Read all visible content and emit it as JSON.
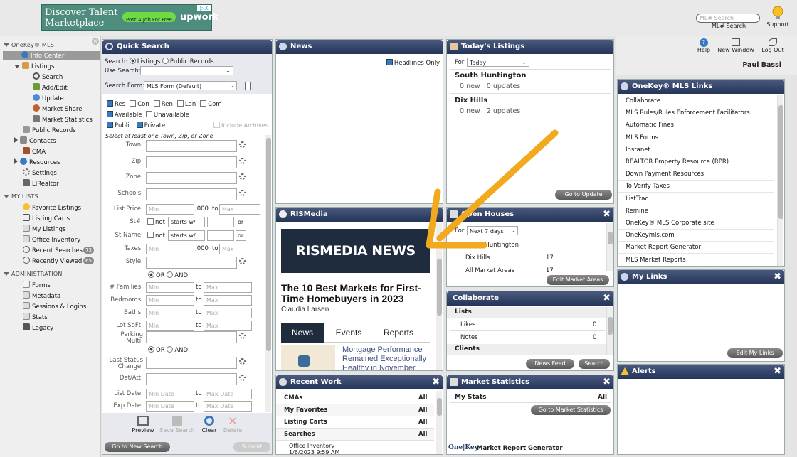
{
  "ad": {
    "line1": "Discover Talent",
    "line2": "Marketplace",
    "cta": "Post A Job For Free",
    "brand": "upwork",
    "badge": "▷X"
  },
  "header": {
    "search_placeholder": "ML# Search",
    "search_label": "ML# Search",
    "support": "Support",
    "help": "Help",
    "new_window": "New Window",
    "logout": "Log Out",
    "user": "Paul Bassi"
  },
  "sidebar": {
    "section_mls": "OneKey® MLS",
    "info_center": "Info Center",
    "listings": "Listings",
    "search": "Search",
    "add_edit": "Add/Edit",
    "update": "Update",
    "market_share": "Market Share",
    "market_statistics": "Market Statistics",
    "public_records": "Public Records",
    "contacts": "Contacts",
    "cma": "CMA",
    "resources": "Resources",
    "settings": "Settings",
    "lirealtor": "LIRealtor",
    "section_lists": "MY LISTS",
    "favorite_listings": "Favorite Listings",
    "listing_carts": "Listing Carts",
    "my_listings": "My Listings",
    "office_inventory": "Office Inventory",
    "recent_searches": "Recent Searches",
    "recent_searches_count": "73",
    "recently_viewed": "Recently Viewed",
    "recently_viewed_count": "65",
    "section_admin": "ADMINISTRATION",
    "forms": "Forms",
    "metadata": "Metadata",
    "sessions": "Sessions & Logins",
    "stats": "Stats",
    "legacy": "Legacy"
  },
  "quick_search": {
    "title": "Quick Search",
    "search_label": "Search:",
    "opt_listings": "Listings",
    "opt_public": "Public Records",
    "use_search": "Use Search:",
    "search_form": "Search Form:",
    "search_form_value": "MLS Form (Default)",
    "types": [
      "Res",
      "Con",
      "Ren",
      "Lan",
      "Com"
    ],
    "available": "Available",
    "unavailable": "Unavailable",
    "public": "Public",
    "private": "Private",
    "include_archives": "Include Archives",
    "hint": "Select at least one Town, Zip, or Zone",
    "town": "Town:",
    "zip": "Zip:",
    "zone": "Zone:",
    "schools": "Schools:",
    "list_price": "List Price:",
    "min": "Min",
    "max": "Max",
    "thousands": ",000",
    "to": "to",
    "street": "St#:",
    "not": "not",
    "starts_with": "starts w/",
    "or": "or",
    "st_name": "St Name:",
    "taxes": "Taxes:",
    "style": "Style:",
    "opt_or": "OR",
    "opt_and": "AND",
    "families": "# Families:",
    "bedrooms": "Bedrooms:",
    "baths": "Baths:",
    "lot_sqft": "Lot SqFt:",
    "parking": "Parking Multi:",
    "last_status": "Last Status Change:",
    "det_att": "Det/Att:",
    "list_date": "List Date:",
    "exp_date": "Exp Date:",
    "min_date": "Min Date",
    "max_date": "Max Date",
    "preview": "Preview",
    "save_search": "Save Search",
    "clear": "Clear",
    "delete": "Delete",
    "go_new_search": "Go to New Search",
    "submit": "Submit"
  },
  "news": {
    "title": "News",
    "headlines_only": "Headlines Only"
  },
  "rismedia": {
    "title": "RISMedia",
    "logo": "RISMEDIA NEWS",
    "headline": "The 10 Best Markets for First-Time Homebuyers in 2023",
    "author": "Claudia Larsen",
    "tabs": [
      "News",
      "Events",
      "Reports"
    ],
    "story": "Mortgage Performance Remained Exceptionally Healthy in November"
  },
  "todays_listings": {
    "title": "Today's Listings",
    "for": "For:",
    "period": "Today",
    "areas": [
      {
        "name": "South Huntington",
        "status": "0 new   0 updates"
      },
      {
        "name": "Dix Hills",
        "status": "0 new   2 updates"
      }
    ],
    "button": "Go to Update"
  },
  "open_houses": {
    "title": "Open Houses",
    "for": "For:",
    "period": "Next 7 days",
    "rows": [
      {
        "name": "South Huntington",
        "count": ""
      },
      {
        "name": "Dix Hills",
        "count": "17"
      },
      {
        "name": "All Market Areas",
        "count": "17"
      }
    ],
    "button": "Edit Market Areas"
  },
  "collaborate": {
    "title": "Collaborate",
    "lists": "Lists",
    "likes": "Likes",
    "likes_count": "0",
    "notes": "Notes",
    "notes_count": "0",
    "clients": "Clients",
    "news_feed": "News Feed",
    "search": "Search"
  },
  "recent_work": {
    "title": "Recent Work",
    "all": "All",
    "rows": [
      "CMAs",
      "My Favorites",
      "Listing Carts",
      "Searches"
    ],
    "item_name": "Office Inventory",
    "item_date": "1/6/2023 9:59 AM"
  },
  "market_statistics": {
    "title": "Market Statistics",
    "my_stats": "My Stats",
    "all": "All",
    "button": "Go to Market Statistics",
    "footer_logo": "One|Key",
    "footer": "Market Report Generator"
  },
  "mls_links": {
    "title": "OneKey® MLS Links",
    "items": [
      "Collaborate",
      "MLS Rules/Rules Enforcement Facilitators",
      "Automatic Fines",
      "MLS Forms",
      "Instanet",
      "REALTOR Property Resource (RPR)",
      "Down Payment Resources",
      "To Verify Taxes",
      "ListTrac",
      "Remine",
      "OneKey® MLS Corporate site",
      "OneKeymls.com",
      "Market Report Generator",
      "MLS Market Reports"
    ]
  },
  "my_links": {
    "title": "My Links",
    "button": "Edit My Links"
  },
  "alerts": {
    "title": "Alerts"
  },
  "colors": {
    "panel_header": "#243559",
    "arrow": "#f2a91d",
    "accent": "#3a78c2"
  }
}
